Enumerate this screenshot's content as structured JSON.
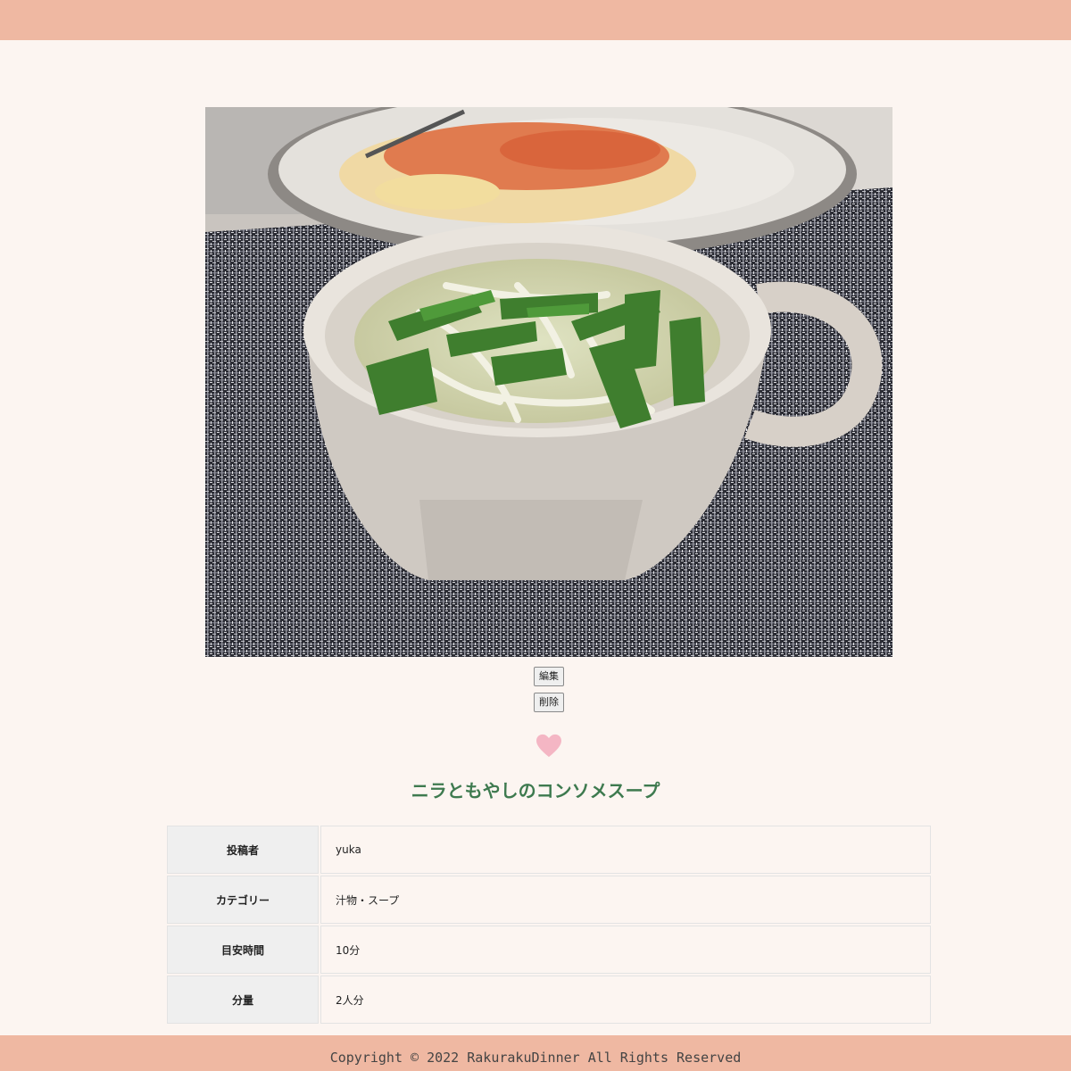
{
  "header": {
    "bar_color": "#efb8a2"
  },
  "recipe": {
    "image_icon": "dish-photo",
    "edit_label": "編集",
    "delete_label": "削除",
    "like_icon": "heart-icon",
    "like_color": "#f4b6c4",
    "title": "ニラともやしのコンソメスープ",
    "title_color": "#3e7a4f"
  },
  "details": {
    "rows": [
      {
        "label": "投稿者",
        "value": "yuka"
      },
      {
        "label": "カテゴリー",
        "value": "汁物・スープ"
      },
      {
        "label": "目安時間",
        "value": "10分"
      },
      {
        "label": "分量",
        "value": "2人分"
      }
    ]
  },
  "footer": {
    "copyright": "Copyright © 2022 RakurakuDinner All Rights Reserved"
  }
}
